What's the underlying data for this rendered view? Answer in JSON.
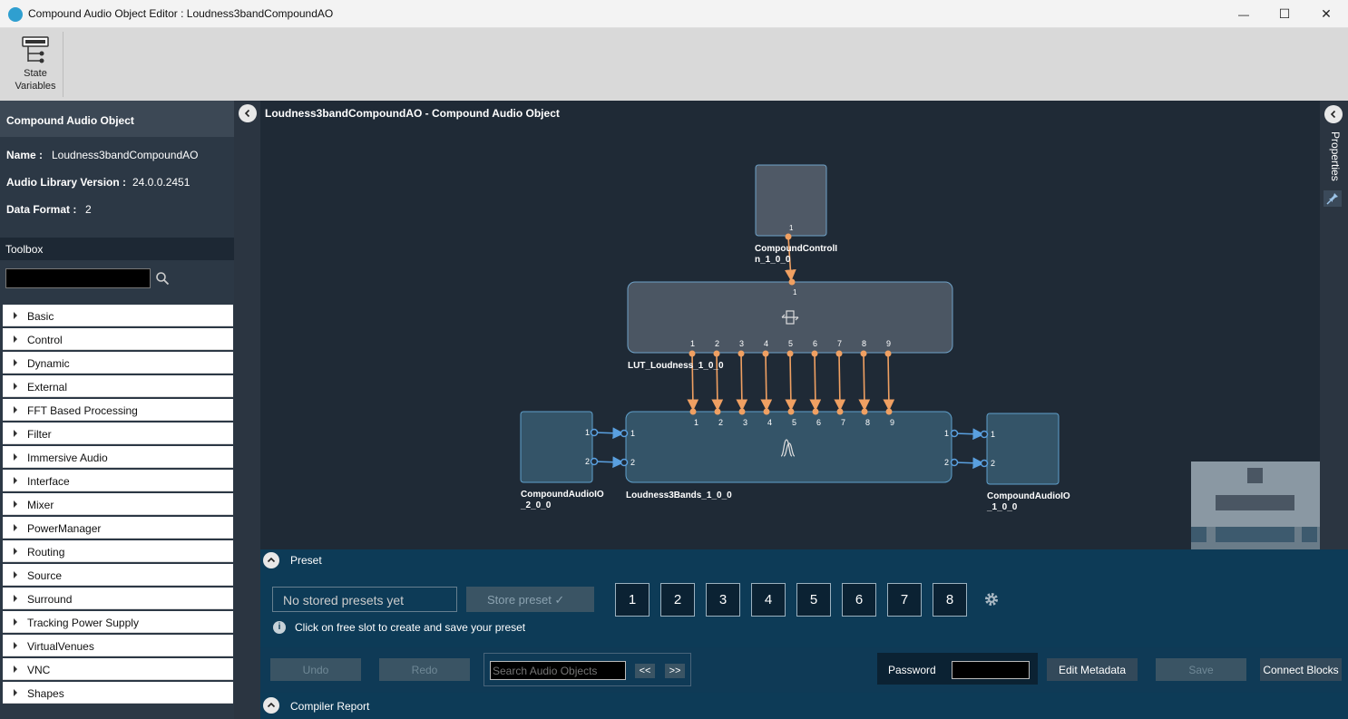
{
  "window": {
    "title": "Compound Audio Object Editor : Loudness3bandCompoundAO",
    "minimize_glyph": "—",
    "maximize_glyph": "☐",
    "close_glyph": "✕"
  },
  "ribbon": {
    "state_vars_line1": "State",
    "state_vars_line2": "Variables",
    "icon": "state-variables-icon"
  },
  "properties": {
    "header": "Compound Audio Object",
    "name_label": "Name :",
    "name_value": "Loudness3bandCompoundAO",
    "version_label": "Audio Library Version :",
    "version_value": "24.0.0.2451",
    "format_label": "Data Format :",
    "format_value": "2"
  },
  "toolbox": {
    "header": "Toolbox",
    "search_value": "",
    "items": [
      "Basic",
      "Control",
      "Dynamic",
      "External",
      "FFT Based Processing",
      "Filter",
      "Immersive Audio",
      "Interface",
      "Mixer",
      "PowerManager",
      "Routing",
      "Source",
      "Surround",
      "Tracking Power Supply",
      "VirtualVenues",
      "VNC",
      "Shapes"
    ]
  },
  "canvas": {
    "title": "Loudness3bandCompoundAO - Compound Audio Object",
    "blocks": {
      "control_in": {
        "line1": "CompoundControlI",
        "line2": "n_1_0_0",
        "out_pin": "1"
      },
      "lut": {
        "label": "LUT_Loudness_1_0_0",
        "in_pin": "1",
        "out_pins": [
          "1",
          "2",
          "3",
          "4",
          "5",
          "6",
          "7",
          "8",
          "9"
        ]
      },
      "bands": {
        "label": "Loudness3Bands_1_0_0",
        "in_pins": [
          "1",
          "2",
          "3",
          "4",
          "5",
          "6",
          "7",
          "8",
          "9"
        ],
        "audio_in": [
          "1",
          "2"
        ],
        "audio_out": [
          "1",
          "2"
        ]
      },
      "io_in": {
        "line1": "CompoundAudioIO",
        "line2": "_2_0_0",
        "pins": [
          "1",
          "2"
        ]
      },
      "io_out": {
        "line1": "CompoundAudioIO",
        "line2": "_1_0_0",
        "pins": [
          "1",
          "2"
        ]
      }
    }
  },
  "right_panel": {
    "tab": "Properties"
  },
  "preset": {
    "title": "Preset",
    "selector": "No stored presets yet",
    "store_button": "Store preset ✓",
    "slots": [
      "1",
      "2",
      "3",
      "4",
      "5",
      "6",
      "7",
      "8"
    ],
    "info_glyph": "i",
    "hint": "Click on free slot to create and save your preset"
  },
  "bottombar": {
    "undo": "Undo",
    "redo": "Redo",
    "search_placeholder": "Search Audio Objects",
    "prev": "<<",
    "next": ">>",
    "password_label": "Password",
    "edit_metadata": "Edit Metadata",
    "save": "Save",
    "connect": "Connect Blocks"
  },
  "compiler": {
    "title": "Compiler Report"
  },
  "colors": {
    "canvas_bg": "#1f2a36",
    "wire_control": "#f0a062",
    "wire_audio": "#5aa0e0",
    "preset_bg": "#0d3b57"
  }
}
